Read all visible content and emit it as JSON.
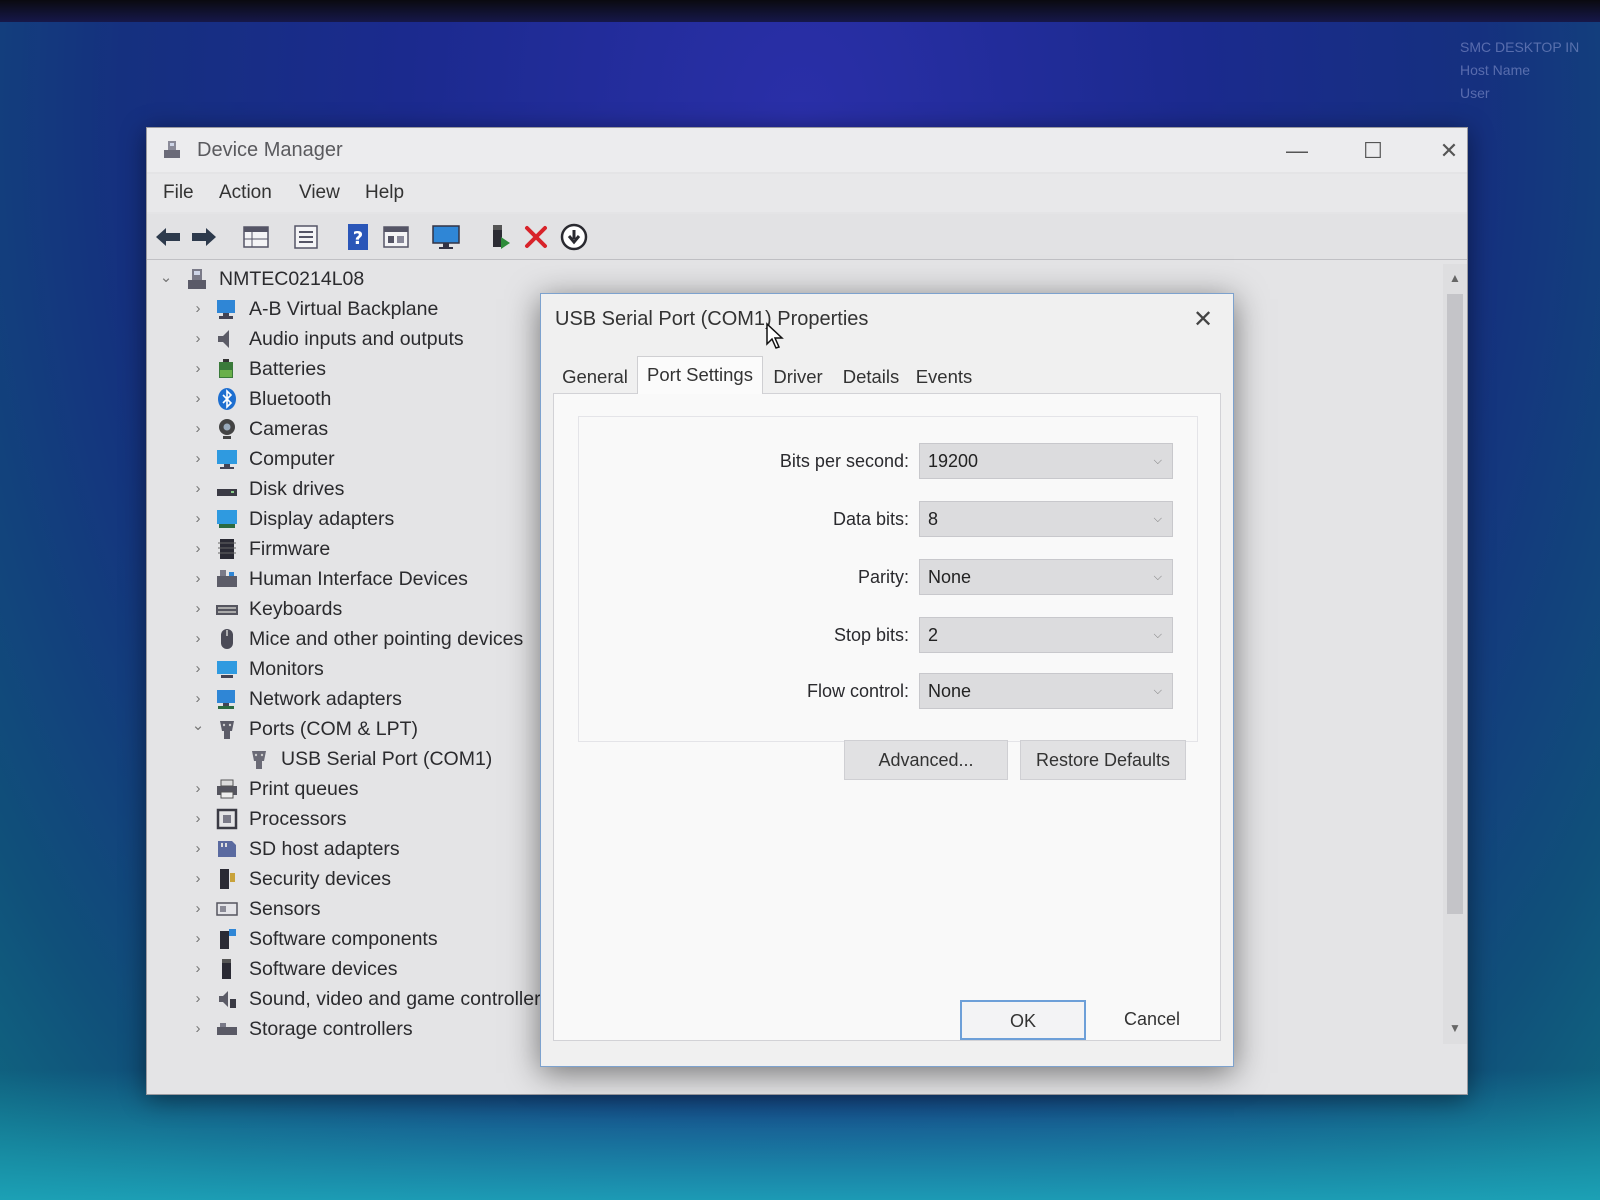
{
  "host_info": [
    "SMC DESKTOP IN",
    "Host Name",
    "User"
  ],
  "window": {
    "title": "Device Manager",
    "controls": {
      "minimize": "—",
      "maximize": "☐",
      "close": "✕"
    }
  },
  "menu": [
    "File",
    "Action",
    "View",
    "Help"
  ],
  "toolbar_icons": [
    "back-arrow-icon",
    "forward-arrow-icon",
    "properties-grid-icon",
    "list-view-icon",
    "help-icon",
    "detail-view-icon",
    "monitor-icon",
    "add-driver-icon",
    "uninstall-x-icon",
    "download-update-icon"
  ],
  "tree": {
    "root": "NMTEC0214L08",
    "items": [
      {
        "label": "A-B Virtual Backplane",
        "expanded": false,
        "level": 1
      },
      {
        "label": "Audio inputs and outputs",
        "expanded": false,
        "level": 1
      },
      {
        "label": "Batteries",
        "expanded": false,
        "level": 1
      },
      {
        "label": "Bluetooth",
        "expanded": false,
        "level": 1
      },
      {
        "label": "Cameras",
        "expanded": false,
        "level": 1
      },
      {
        "label": "Computer",
        "expanded": false,
        "level": 1
      },
      {
        "label": "Disk drives",
        "expanded": false,
        "level": 1
      },
      {
        "label": "Display adapters",
        "expanded": false,
        "level": 1
      },
      {
        "label": "Firmware",
        "expanded": false,
        "level": 1
      },
      {
        "label": "Human Interface Devices",
        "expanded": false,
        "level": 1
      },
      {
        "label": "Keyboards",
        "expanded": false,
        "level": 1
      },
      {
        "label": "Mice and other pointing devices",
        "expanded": false,
        "level": 1
      },
      {
        "label": "Monitors",
        "expanded": false,
        "level": 1
      },
      {
        "label": "Network adapters",
        "expanded": false,
        "level": 1
      },
      {
        "label": "Ports (COM & LPT)",
        "expanded": true,
        "level": 1
      },
      {
        "label": "USB Serial Port (COM1)",
        "expanded": null,
        "level": 2
      },
      {
        "label": "Print queues",
        "expanded": false,
        "level": 1
      },
      {
        "label": "Processors",
        "expanded": false,
        "level": 1
      },
      {
        "label": "SD host adapters",
        "expanded": false,
        "level": 1
      },
      {
        "label": "Security devices",
        "expanded": false,
        "level": 1
      },
      {
        "label": "Sensors",
        "expanded": false,
        "level": 1
      },
      {
        "label": "Software components",
        "expanded": false,
        "level": 1
      },
      {
        "label": "Software devices",
        "expanded": false,
        "level": 1
      },
      {
        "label": "Sound, video and game controllers",
        "expanded": false,
        "level": 1
      },
      {
        "label": "Storage controllers",
        "expanded": false,
        "level": 1
      }
    ]
  },
  "dialog": {
    "title": "USB Serial Port (COM1) Properties",
    "close": "✕",
    "tabs": [
      {
        "label": "General",
        "active": false
      },
      {
        "label": "Port Settings",
        "active": true
      },
      {
        "label": "Driver",
        "active": false
      },
      {
        "label": "Details",
        "active": false
      },
      {
        "label": "Events",
        "active": false
      }
    ],
    "fields": [
      {
        "label": "Bits per second:",
        "value": "19200"
      },
      {
        "label": "Data bits:",
        "value": "8"
      },
      {
        "label": "Parity:",
        "value": "None"
      },
      {
        "label": "Stop bits:",
        "value": "2"
      },
      {
        "label": "Flow control:",
        "value": "None"
      }
    ],
    "advanced_button": "Advanced...",
    "restore_button": "Restore Defaults",
    "ok_button": "OK",
    "cancel_button": "Cancel"
  },
  "colors": {
    "accent_border": "#6d9fd8",
    "folder_blue": "#2f86d6",
    "delete_red": "#d8232a",
    "add_green": "#2e8b3a"
  }
}
